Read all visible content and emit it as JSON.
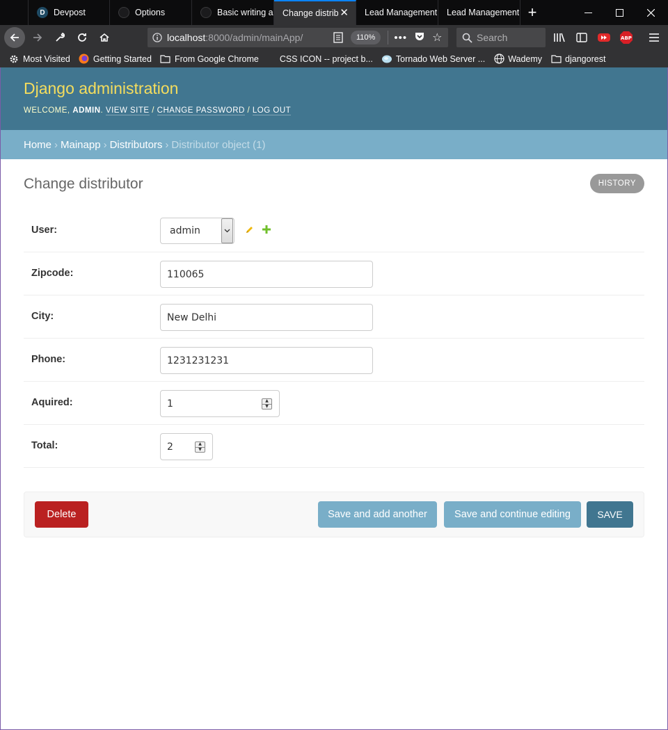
{
  "browser": {
    "tabs": [
      {
        "label": "Devpost",
        "favicon": "D"
      },
      {
        "label": "Options",
        "favicon": ""
      },
      {
        "label": "Basic writing a",
        "favicon": ""
      },
      {
        "label": "Change distrib",
        "favicon": ""
      },
      {
        "label": "Lead Management",
        "favicon": ""
      },
      {
        "label": "Lead Management",
        "favicon": ""
      }
    ],
    "active_tab_index": 3,
    "url_host": "localhost",
    "url_rest": ":8000/admin/mainApp/",
    "zoom": "110%",
    "search_placeholder": "Search",
    "bookmarks": [
      {
        "label": "Most Visited",
        "icon": "gear-icon"
      },
      {
        "label": "Getting Started",
        "icon": "firefox-icon"
      },
      {
        "label": "From Google Chrome",
        "icon": "folder-icon"
      },
      {
        "label": "CSS ICON -- project b...",
        "icon": "none"
      },
      {
        "label": "Tornado Web Server ...",
        "icon": "tornado-icon"
      },
      {
        "label": "Wademy",
        "icon": "globe-icon"
      },
      {
        "label": "djangorest",
        "icon": "folder-icon"
      }
    ],
    "colors": {
      "active_tab_accent": "#0a84ff",
      "toolbar": "#323234",
      "tabstrip": "#0c0c0d"
    }
  },
  "admin": {
    "site_title": "Django administration",
    "welcome": "Welcome,",
    "username": "admin",
    "view_site": "View site",
    "change_password": "Change password",
    "log_out": "Log out",
    "breadcrumbs": {
      "home": "Home",
      "app": "Mainapp",
      "model": "Distributors",
      "current": "Distributor object (1)"
    },
    "page_title": "Change distributor",
    "history_label": "History",
    "fields": {
      "user": {
        "label": "User:",
        "value": "admin"
      },
      "zipcode": {
        "label": "Zipcode:",
        "value": "110065"
      },
      "city": {
        "label": "City:",
        "value": "New Delhi"
      },
      "phone": {
        "label": "Phone:",
        "value": "1231231231"
      },
      "aquired": {
        "label": "Aquired:",
        "value": "1"
      },
      "total": {
        "label": "Total:",
        "value": "2"
      }
    },
    "buttons": {
      "delete": "Delete",
      "save_add_another": "Save and add another",
      "save_continue": "Save and continue editing",
      "save": "Save"
    },
    "colors": {
      "header": "#417690",
      "branding": "#f5dd5d",
      "breadcrumbs": "#79aec8",
      "delete": "#ba2121",
      "save": "#417690",
      "secondary_button": "#79aec8"
    }
  }
}
